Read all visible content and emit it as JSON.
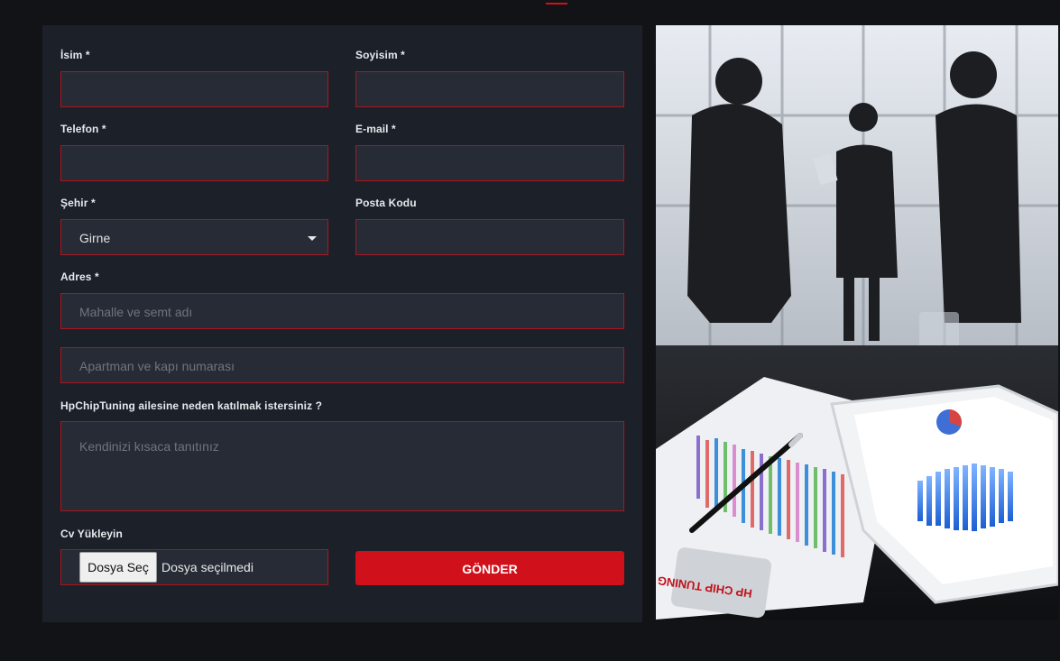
{
  "form": {
    "first_name_label": "İsim *",
    "last_name_label": "Soyisim *",
    "phone_label": "Telefon *",
    "email_label": "E-mail *",
    "city_label": "Şehir *",
    "city_value": "Girne",
    "postal_code_label": "Posta Kodu",
    "address_label": "Adres *",
    "address1_placeholder": "Mahalle ve semt adı",
    "address2_placeholder": "Apartman ve kapı numarası",
    "why_join_label": "HpChipTuning ailesine neden katılmak istersiniz ?",
    "why_join_placeholder": "Kendinizi kısaca tanıtınız",
    "cv_label": "Cv Yükleyin",
    "choose_file_label": "Dosya Seç",
    "no_file_text": "Dosya seçilmedi",
    "submit_label": "GÖNDER"
  },
  "image": {
    "subject": "business-meeting-photo",
    "brand_text": "HP CHIP TUNING"
  },
  "colors": {
    "page_bg": "#121316",
    "panel_bg": "#1b2029",
    "field_bg": "#262b35",
    "field_border": "#b0141c",
    "accent": "#d0101a"
  }
}
